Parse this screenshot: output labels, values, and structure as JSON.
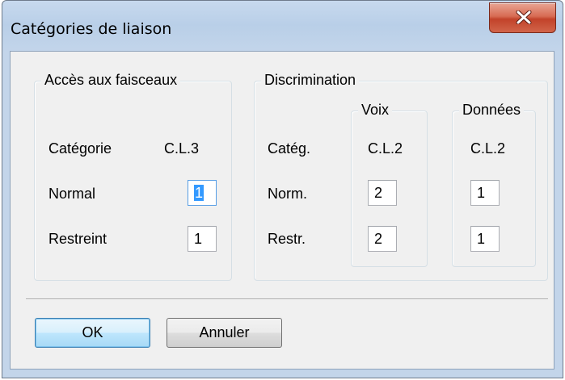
{
  "window": {
    "title": "Catégories de liaison"
  },
  "access": {
    "legend": "Accès aux faisceaux",
    "category_label": "Catégorie",
    "category_value": "C.L.3",
    "normal_label": "Normal",
    "normal_value": "1",
    "restricted_label": "Restreint",
    "restricted_value": "1"
  },
  "discrimination": {
    "legend": "Discrimination",
    "category_label": "Catég.",
    "normal_label": "Norm.",
    "restricted_label": "Restr.",
    "voice": {
      "legend": "Voix",
      "category_value": "C.L.2",
      "normal_value": "2",
      "restricted_value": "2"
    },
    "data": {
      "legend": "Données",
      "category_value": "C.L.2",
      "normal_value": "1",
      "restricted_value": "1"
    }
  },
  "buttons": {
    "ok": "OK",
    "cancel": "Annuler"
  },
  "colors": {
    "close_button": "#c7432a",
    "focus_selection": "#3399ff"
  }
}
